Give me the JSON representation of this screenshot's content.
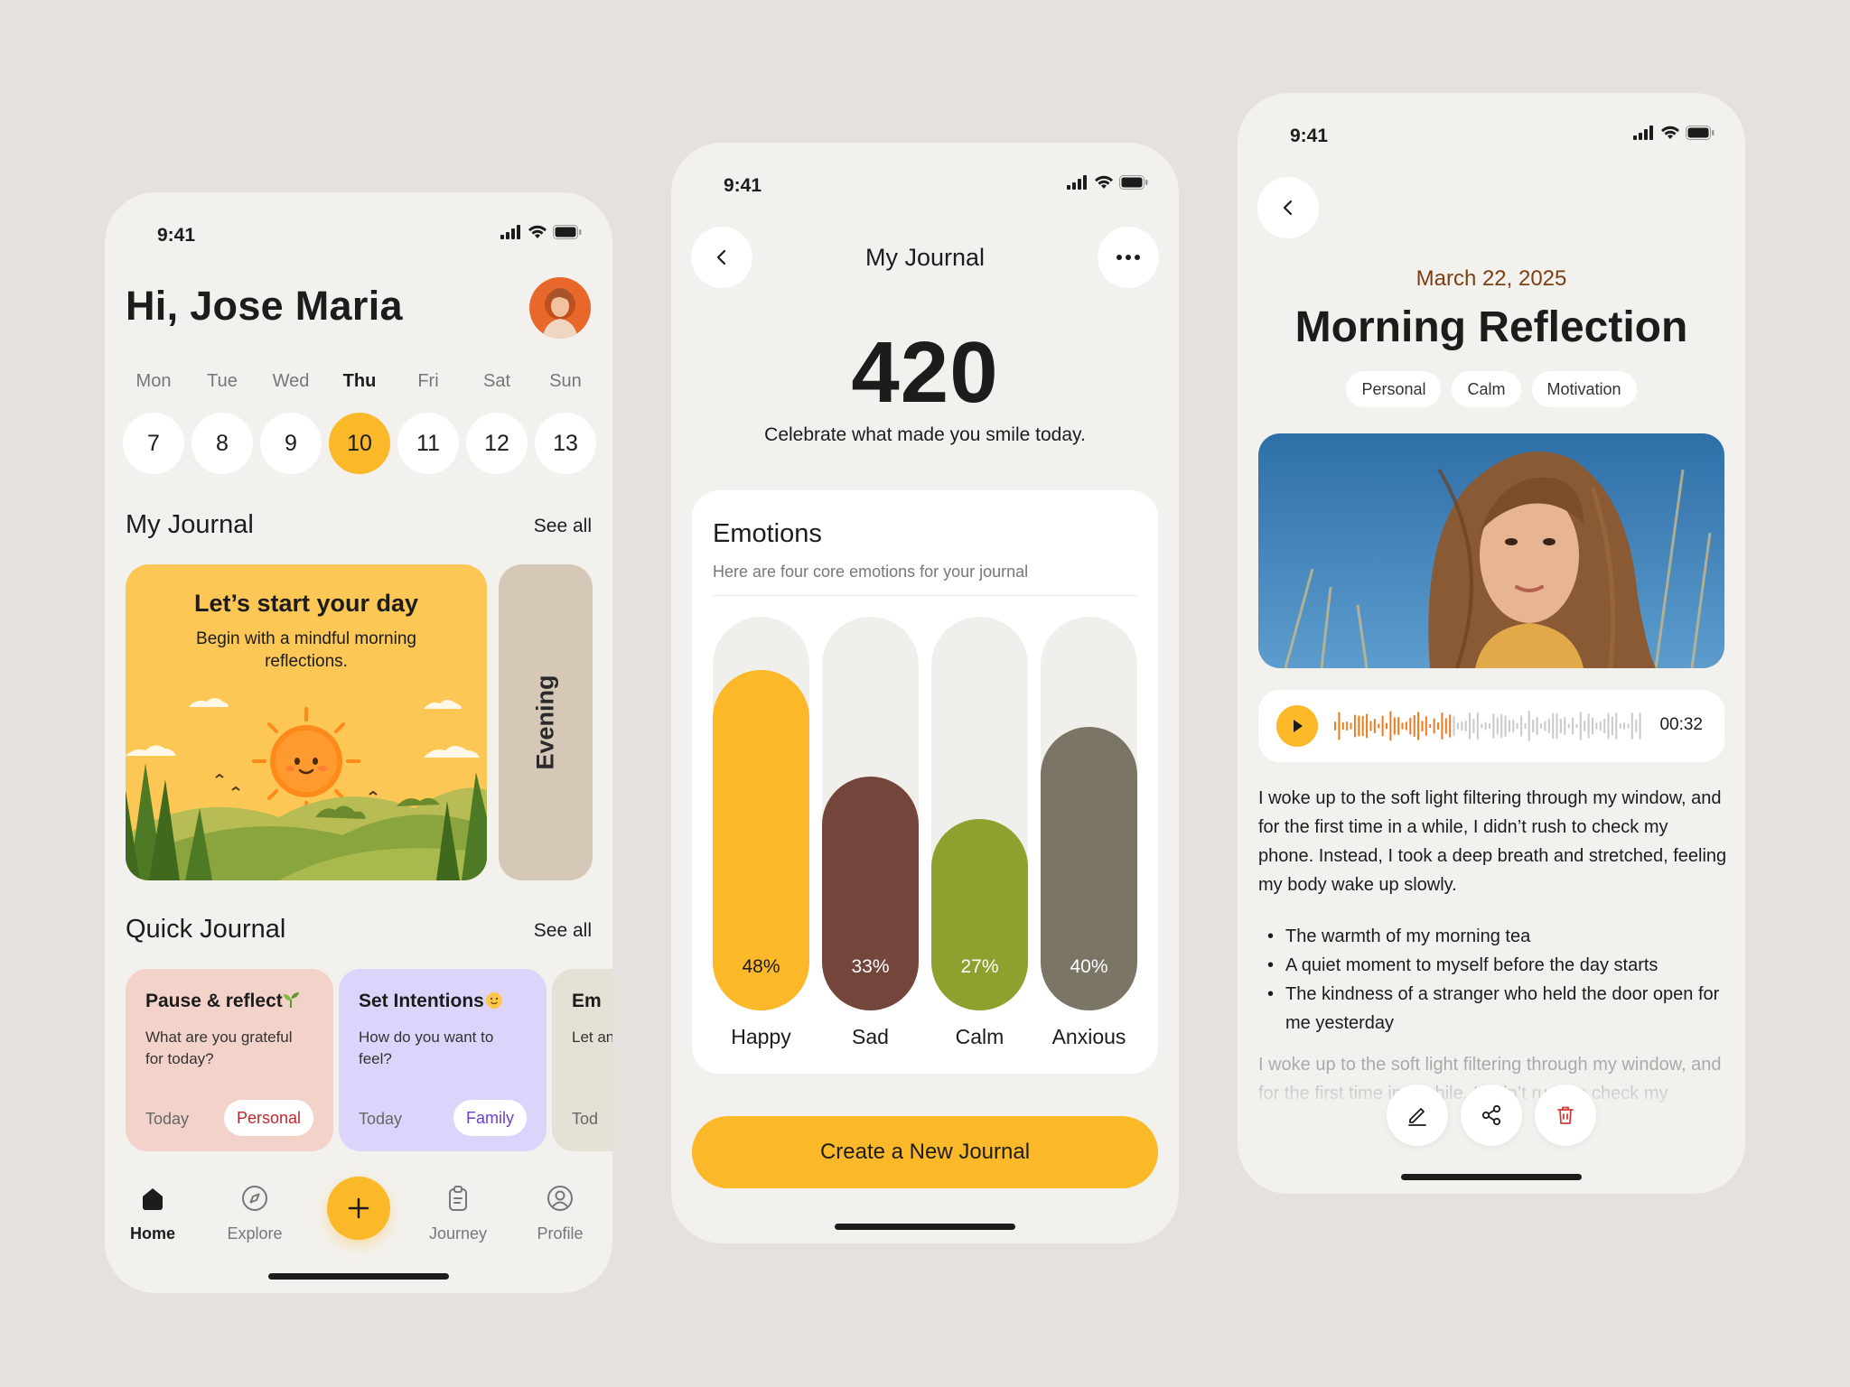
{
  "status": {
    "time": "9:41"
  },
  "home": {
    "greeting": "Hi, Jose Maria",
    "days": [
      {
        "name": "Mon",
        "date": "7",
        "selected": false
      },
      {
        "name": "Tue",
        "date": "8",
        "selected": false
      },
      {
        "name": "Wed",
        "date": "9",
        "selected": false
      },
      {
        "name": "Thu",
        "date": "10",
        "selected": true
      },
      {
        "name": "Fri",
        "date": "11",
        "selected": false
      },
      {
        "name": "Sat",
        "date": "12",
        "selected": false
      },
      {
        "name": "Sun",
        "date": "13",
        "selected": false
      }
    ],
    "journal_title": "My Journal",
    "see_all": "See all",
    "day_card": {
      "title": "Let’s start your day",
      "subtitle": "Begin with a mindful morning reflections."
    },
    "evening_card": "Evening",
    "quick_title": "Quick Journal",
    "quick_cards": [
      {
        "title": "Pause & reflect",
        "question": "What are you grateful for today?",
        "day": "Today",
        "tag": "Personal",
        "bg": "#f3d3c9",
        "tag_color": "#c0272d"
      },
      {
        "title": "Set Intentions",
        "question": "How do you want to feel?",
        "day": "Today",
        "tag": "Family",
        "bg": "#dcd4fb",
        "tag_color": "#6b3fd1"
      },
      {
        "title": "Em",
        "question": "Let and",
        "day": "Tod",
        "tag": "",
        "bg": "#e6e1d6",
        "tag_color": "#333"
      }
    ],
    "nav": [
      {
        "label": "Home",
        "icon": "home-icon",
        "active": true
      },
      {
        "label": "Explore",
        "icon": "compass-icon",
        "active": false
      },
      {
        "label": "Journey",
        "icon": "clipboard-icon",
        "active": false
      },
      {
        "label": "Profile",
        "icon": "user-icon",
        "active": false
      }
    ]
  },
  "journal": {
    "title": "My Journal",
    "count": "420",
    "subtitle": "Celebrate what made you smile today.",
    "emotions_title": "Emotions",
    "emotions_subtitle": "Here are four core emotions for your journal",
    "cta": "Create a New Journal"
  },
  "chart_data": {
    "type": "bar",
    "categories": [
      "Happy",
      "Sad",
      "Calm",
      "Anxious"
    ],
    "values": [
      48,
      33,
      27,
      40
    ],
    "labels": [
      "48%",
      "33%",
      "27%",
      "40%"
    ],
    "colors": [
      "#fbb829",
      "#74453a",
      "#8ca12e",
      "#7a7565"
    ],
    "ylim": [
      0,
      100
    ],
    "title": "Emotions"
  },
  "entry": {
    "date": "March 22, 2025",
    "title": "Morning Reflection",
    "tags": [
      "Personal",
      "Calm",
      "Motivation"
    ],
    "audio_duration": "00:32",
    "audio_progress": 0.38,
    "body": "I woke up to the soft light filtering through my window, and for the first time in a while, I didn’t rush to check my phone. Instead, I took a deep breath and stretched, feeling my body wake up slowly.",
    "bullets": [
      "The warmth of my morning tea",
      "A quiet moment to myself before the day starts",
      "The kindness of a stranger who held the door open for me yesterday"
    ],
    "faded": "I woke up to the soft light filtering through my window, and for the first time in a while, I didn’t rush to check my"
  },
  "accent": "#fbb829"
}
